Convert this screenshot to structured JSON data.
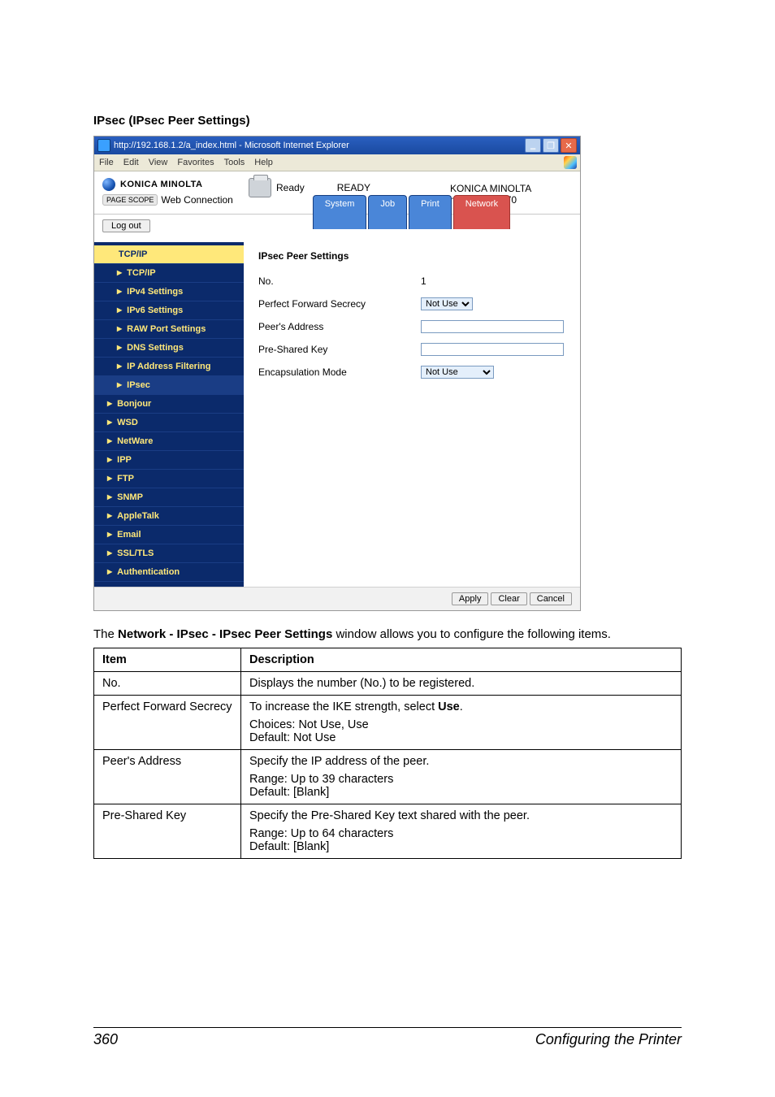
{
  "heading": "IPsec (IPsec Peer Settings)",
  "screenshot": {
    "titlebar": "http://192.168.1.2/a_index.html - Microsoft Internet Explorer",
    "menus": [
      "File",
      "Edit",
      "View",
      "Favorites",
      "Tools",
      "Help"
    ],
    "brand_name": "KONICA MINOLTA",
    "pagescope_badge": "PAGE SCOPE",
    "pagescope_text": "Web Connection",
    "ready_label": "Ready",
    "ready_big": "READY",
    "device_vendor": "KONICA MINOLTA",
    "device_model": "magicolor 5670",
    "logout": "Log out",
    "tabs": [
      {
        "label": "System",
        "active": false
      },
      {
        "label": "Job",
        "active": false
      },
      {
        "label": "Print",
        "active": false
      },
      {
        "label": "Network",
        "active": true
      }
    ],
    "side": {
      "group": "TCP/IP",
      "items": [
        {
          "label": "TCP/IP"
        },
        {
          "label": "IPv4 Settings"
        },
        {
          "label": "IPv6 Settings"
        },
        {
          "label": "RAW Port Settings"
        },
        {
          "label": "DNS Settings"
        },
        {
          "label": "IP Address Filtering"
        },
        {
          "label": "IPsec",
          "selected": true
        }
      ],
      "rest": [
        "Bonjour",
        "WSD",
        "NetWare",
        "IPP",
        "FTP",
        "SNMP",
        "AppleTalk",
        "Email",
        "SSL/TLS",
        "Authentication"
      ]
    },
    "pane": {
      "title": "IPsec Peer Settings",
      "rows": {
        "no_label": "No.",
        "no_value": "1",
        "pfs_label": "Perfect Forward Secrecy",
        "pfs_value": "Not Use",
        "addr_label": "Peer's Address",
        "addr_value": "",
        "psk_label": "Pre-Shared Key",
        "psk_value": "",
        "encap_label": "Encapsulation Mode",
        "encap_value": "Not Use"
      }
    },
    "buttons": {
      "apply": "Apply",
      "clear": "Clear",
      "cancel": "Cancel"
    }
  },
  "caption": {
    "prefix": "The ",
    "bold": "Network - IPsec - IPsec Peer Settings",
    "suffix": " window allows you to configure the following items."
  },
  "table": {
    "head_item": "Item",
    "head_desc": "Description",
    "rows": [
      {
        "item": "No.",
        "desc_lines": [
          "Displays the number (No.) to be registered."
        ]
      },
      {
        "item": "Perfect Forward Secrecy",
        "desc_line1_pre": "To increase the IKE strength, select ",
        "desc_line1_bold": "Use",
        "desc_line1_post": ".",
        "desc_lines": [
          "Choices: Not Use, Use",
          "Default:  Not Use"
        ]
      },
      {
        "item": "Peer's Address",
        "desc_line1": "Specify the IP address of the peer.",
        "desc_lines": [
          "Range:   Up to 39 characters",
          "Default:  [Blank]"
        ]
      },
      {
        "item": "Pre-Shared Key",
        "desc_line1": "Specify the Pre-Shared Key text shared with the peer.",
        "desc_lines": [
          "Range:   Up to 64 characters",
          "Default:  [Blank]"
        ]
      }
    ]
  },
  "footer": {
    "page": "360",
    "title": "Configuring the Printer"
  }
}
